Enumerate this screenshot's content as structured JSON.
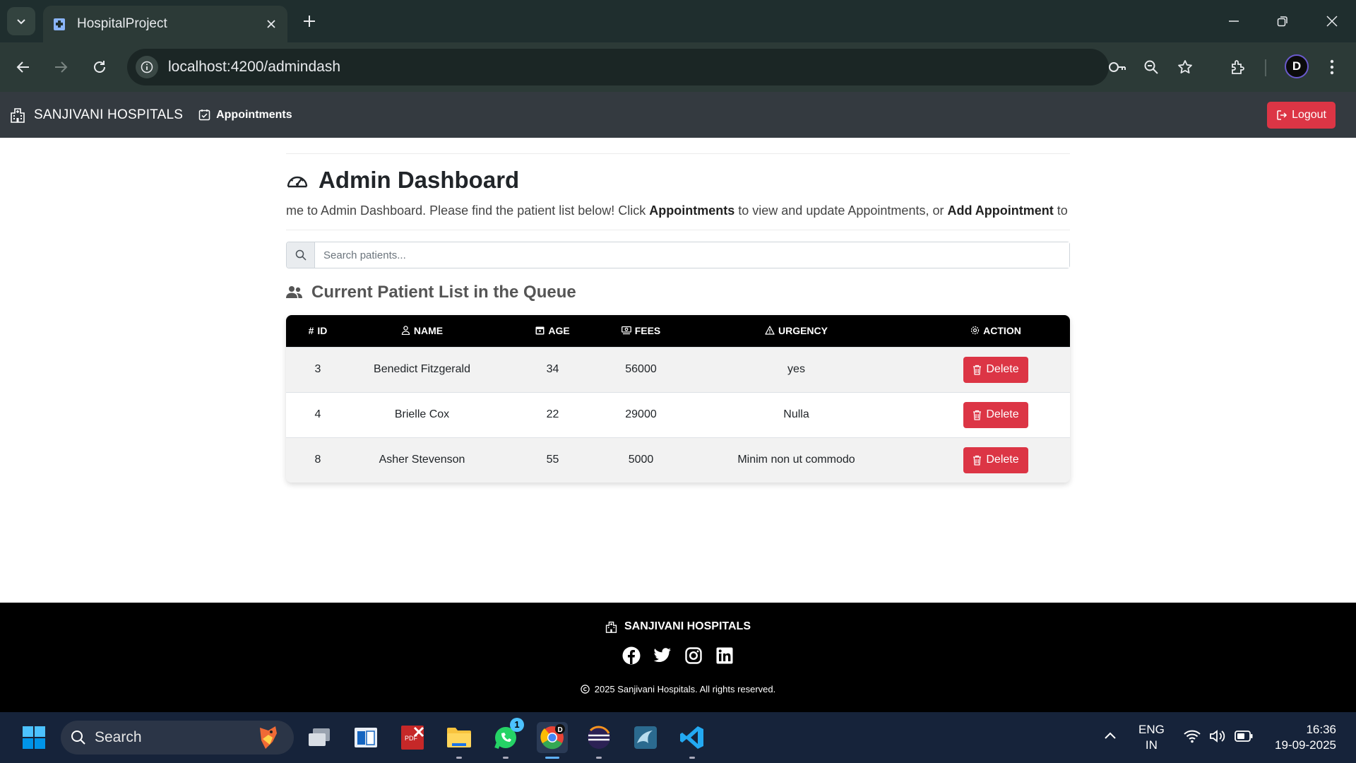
{
  "browser": {
    "tab_title": "HospitalProject",
    "url": "localhost:4200/admindash"
  },
  "navbar": {
    "brand": "SANJIVANI HOSPITALS",
    "appointments_link": "Appointments",
    "logout_label": "Logout"
  },
  "main": {
    "title": "Admin Dashboard",
    "welcome_pre": "me to Admin Dashboard. Please find the patient list below! Click ",
    "welcome_bold1": "Appointments",
    "welcome_mid": " to view and update Appointments, or ",
    "welcome_bold2": "Add Appointment",
    "welcome_post": " to",
    "search_placeholder": "Search patients...",
    "section_title": "Current Patient List in the Queue",
    "table": {
      "headers": [
        "ID",
        "NAME",
        "AGE",
        "FEES",
        "URGENCY",
        "ACTION"
      ],
      "rows": [
        {
          "id": "3",
          "name": "Benedict Fitzgerald",
          "age": "34",
          "fees": "56000",
          "urgency": "yes",
          "action": "Delete"
        },
        {
          "id": "4",
          "name": "Brielle Cox",
          "age": "22",
          "fees": "29000",
          "urgency": "Nulla",
          "action": "Delete"
        },
        {
          "id": "8",
          "name": "Asher Stevenson",
          "age": "55",
          "fees": "5000",
          "urgency": "Minim non ut commodo",
          "action": "Delete"
        }
      ]
    }
  },
  "footer": {
    "brand": "SANJIVANI HOSPITALS",
    "social_icons": [
      "facebook-icon",
      "twitter-icon",
      "instagram-icon",
      "linkedin-icon"
    ],
    "copyright": "2025 Sanjivani Hospitals. All rights reserved."
  },
  "taskbar": {
    "search_label": "Search",
    "whatsapp_badge": "1",
    "lang_top": "ENG",
    "lang_bottom": "IN",
    "time": "16:36",
    "date": "19-09-2025"
  },
  "colors": {
    "navbar_bg": "#343a40",
    "danger": "#dc3545",
    "footer_bg": "#000000",
    "table_header_bg": "#000000"
  }
}
